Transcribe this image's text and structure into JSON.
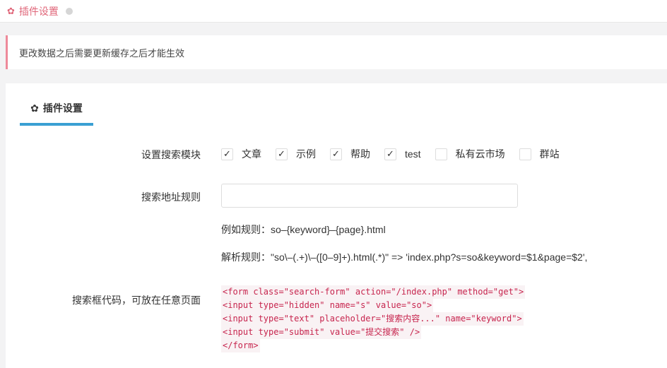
{
  "topbar": {
    "title": "插件设置",
    "gear_icon": "gear-icon"
  },
  "alert": {
    "text": "更改数据之后需要更新缓存之后才能生效"
  },
  "tab": {
    "label": "插件设置"
  },
  "form": {
    "modules_label": "设置搜索模块",
    "modules": [
      {
        "label": "文章",
        "checked": true
      },
      {
        "label": "示例",
        "checked": true
      },
      {
        "label": "帮助",
        "checked": true
      },
      {
        "label": "test",
        "checked": true
      },
      {
        "label": "私有云市场",
        "checked": false
      },
      {
        "label": "群站",
        "checked": false
      }
    ],
    "url_rule_label": "搜索地址规则",
    "url_rule_value": "",
    "example_rule": "例如规则：so–{keyword}–{page}.html",
    "parse_rule": "解析规则：\"so\\–(.+)\\–([0–9]+).html(.*)\" => 'index.php?s=so&keyword=$1&page=$2',",
    "code_label": "搜索框代码，可放在任意页面",
    "code_lines": [
      "<form class=\"search-form\" action=\"/index.php\" method=\"get\">",
      "<input type=\"hidden\" name=\"s\" value=\"so\">",
      "<input type=\"text\" placeholder=\"搜索内容...\" name=\"keyword\">",
      "<input type=\"submit\" value=\"提交搜索\" />",
      "</form>"
    ]
  }
}
